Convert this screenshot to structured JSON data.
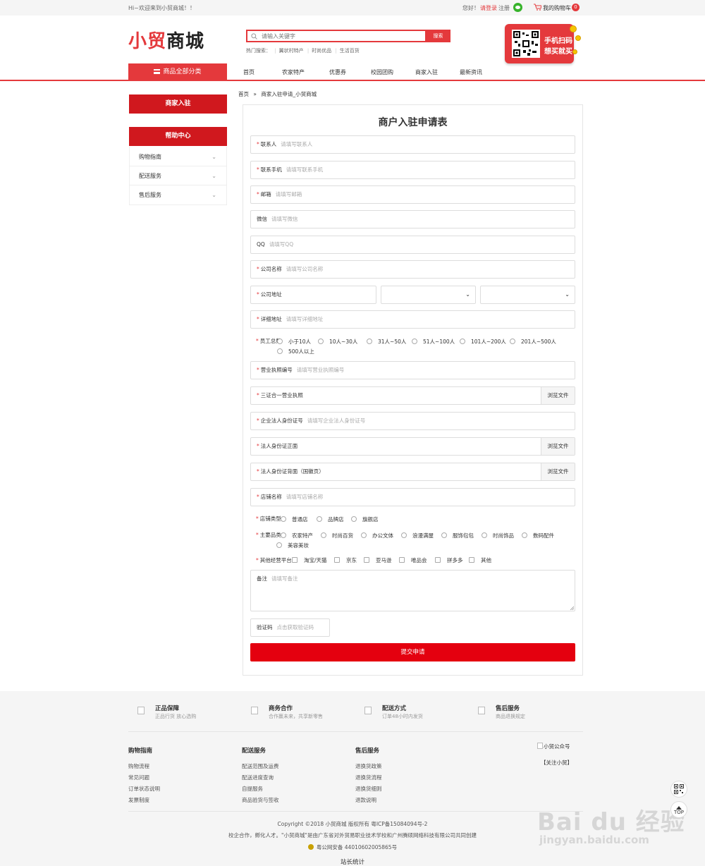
{
  "topbar": {
    "welcome": "Hi~欢迎来到小贸商城！！",
    "hello": "您好！",
    "login": "请登录",
    "register": "注册",
    "cart": "我的购物车",
    "cart_count": "0"
  },
  "header": {
    "logo_red": "小贸",
    "logo_black": "商城",
    "search_placeholder": "请输入关键字",
    "search_button": "搜索",
    "hot_label": "热门搜索：",
    "hot_words": [
      "翼状村特产",
      "时尚优品",
      "生活百货"
    ],
    "promo_line1": "手机扫码",
    "promo_line2": "想买就买"
  },
  "nav": {
    "all_categories": "商品全部分类",
    "items": [
      "首页",
      "农家特产",
      "优惠券",
      "校园团购",
      "商家入驻",
      "最新资讯"
    ]
  },
  "breadcrumb": {
    "home": "首页",
    "sep": "»",
    "current": "商家入驻申请_小贸商城"
  },
  "sidebar": {
    "merchant": "商家入驻",
    "help": "帮助中心",
    "items": [
      "购物指南",
      "配送服务",
      "售后服务"
    ]
  },
  "form": {
    "title": "商户入驻申请表",
    "contact": {
      "label": "联系人",
      "placeholder": "请填写联系人"
    },
    "phone": {
      "label": "联系手机",
      "placeholder": "请填写联系手机"
    },
    "email": {
      "label": "邮箱",
      "placeholder": "请填写邮箱"
    },
    "wechat": {
      "label": "微信",
      "placeholder": "请填写微信"
    },
    "qq": {
      "label": "QQ",
      "placeholder": "请填写QQ"
    },
    "company": {
      "label": "公司名称",
      "placeholder": "请填写公司名称"
    },
    "address": {
      "label": "公司地址"
    },
    "detail": {
      "label": "详细地址",
      "placeholder": "请填写详细地址"
    },
    "staff": {
      "label": "员工总数",
      "options": [
        "小于10人",
        "10人~30人",
        "31人~50人",
        "51人~100人",
        "101人~200人",
        "201人~500人",
        "500人以上"
      ]
    },
    "license_no": {
      "label": "营业执照编号",
      "placeholder": "请填写营业执照编号"
    },
    "license_file": {
      "label": "三证合一营业执照",
      "button": "浏览文件"
    },
    "legal_id": {
      "label": "企业法人身份证号",
      "placeholder": "请填写企业法人身份证号"
    },
    "id_front": {
      "label": "法人身份证正面",
      "button": "浏览文件"
    },
    "id_back": {
      "label": "法人身份证背面（国徽页）",
      "button": "浏览文件"
    },
    "shop_name": {
      "label": "店铺名称",
      "placeholder": "请填写店铺名称"
    },
    "shop_type": {
      "label": "店铺类型",
      "options": [
        "普通店",
        "品牌店",
        "旗舰店"
      ]
    },
    "category": {
      "label": "主要品类",
      "options": [
        "农家特产",
        "时尚百货",
        "办公文体",
        "浪漫满屋",
        "服饰包包",
        "时尚饰品",
        "数码配件",
        "美容美妆"
      ]
    },
    "platforms": {
      "label": "其他经营平台",
      "options": [
        "淘宝/天猫",
        "京东",
        "亚马逊",
        "唯品会",
        "拼多多",
        "其他"
      ]
    },
    "remark": {
      "label": "备注",
      "placeholder": "请填写备注"
    },
    "captcha": {
      "label": "验证码",
      "placeholder": "点击获取验证码"
    },
    "submit": "提交申请"
  },
  "footer": {
    "features": [
      {
        "title": "正品保障",
        "sub": "正品行货 放心选购"
      },
      {
        "title": "商务合作",
        "sub": "合作赢未来，共享新零售"
      },
      {
        "title": "配送方式",
        "sub": "订单48小时内发货"
      },
      {
        "title": "售后服务",
        "sub": "商品退换规定"
      }
    ],
    "columns": [
      {
        "title": "购物指南",
        "links": [
          "购物流程",
          "常见问题",
          "订单状态说明",
          "发票制度"
        ]
      },
      {
        "title": "配送服务",
        "links": [
          "配送范围及运费",
          "配送进度查询",
          "自提服务",
          "商品验货与签收"
        ]
      },
      {
        "title": "售后服务",
        "links": [
          "退换货政策",
          "退换货流程",
          "退换货细则",
          "退款说明"
        ]
      }
    ],
    "qr_alt": "小贸公众号",
    "follow": "【关注小贸】",
    "copyright": "Copyright ©2018 小贸商城 版权所有  粤ICP备15084094号-2",
    "partner": "校企合作，孵化人才。\"小贸商城\"是由广东省对外贸易职业技术学校和广州腾硕网络科技有限公司共同创建",
    "police": "粤公网安备 44010602005865号",
    "stats": "站长统计",
    "top": "TOP"
  },
  "watermark": {
    "line1": "Bai du 经验",
    "line2": "jingyan.baidu.com"
  }
}
